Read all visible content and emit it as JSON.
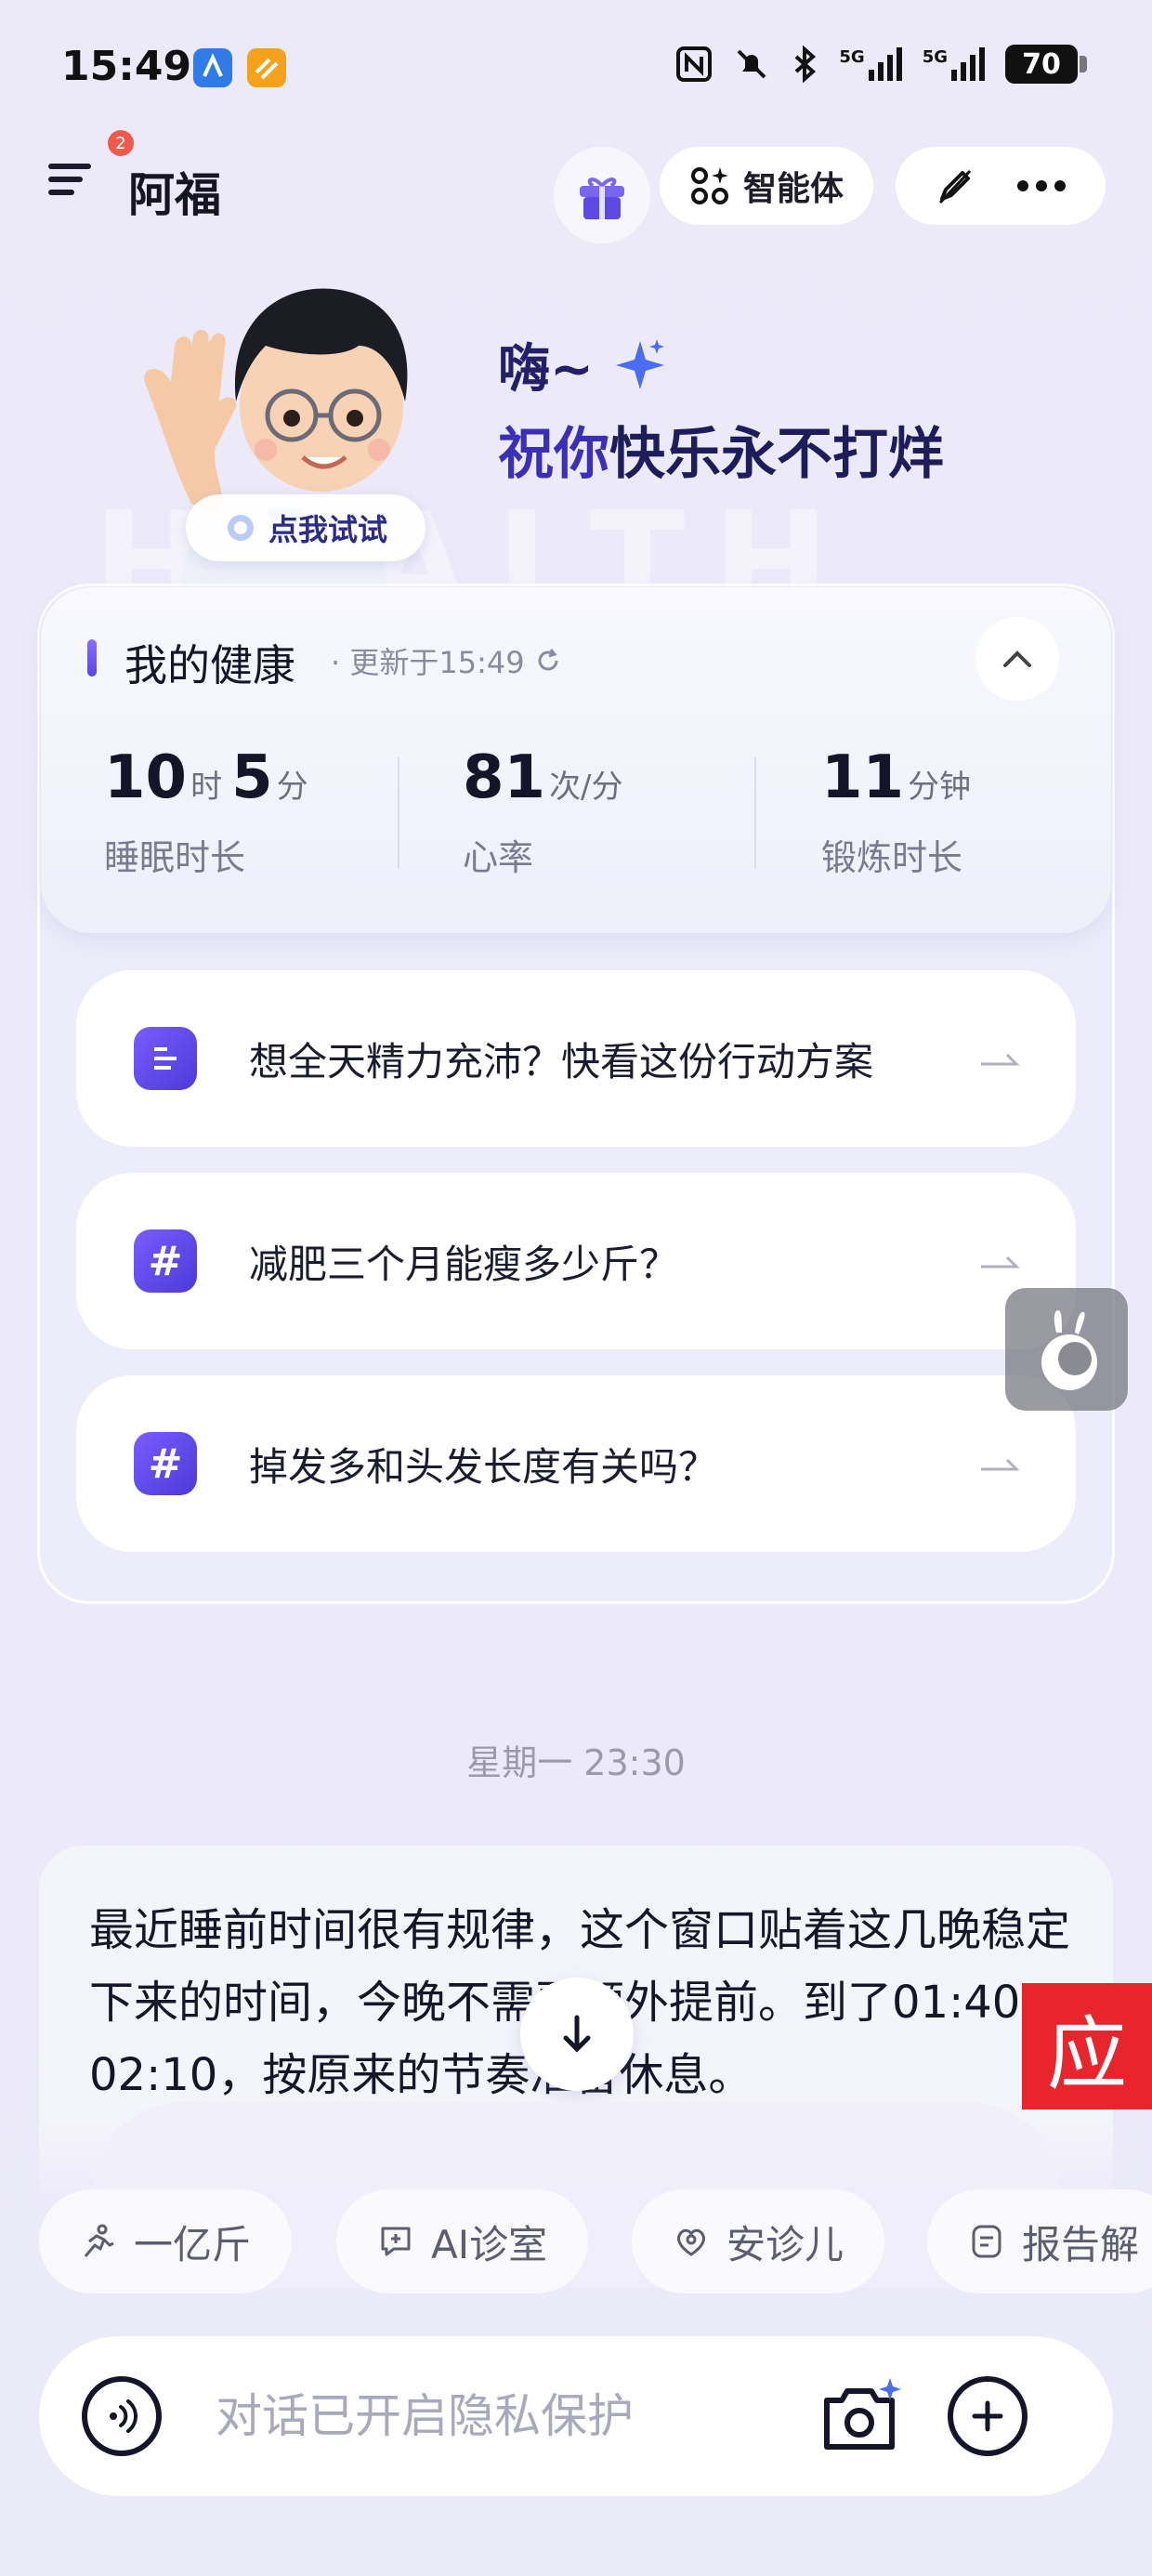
{
  "status_bar": {
    "time": "15:49",
    "battery": "70",
    "signal_1": "5G",
    "signal_2": "5G"
  },
  "header": {
    "menu_badge": "2",
    "title": "阿福",
    "agent_label": "智能体"
  },
  "hero": {
    "greeting": "嗨~",
    "subtitle_part1": "祝你",
    "subtitle_part2": "快乐永不打烊",
    "try_button": "点我试试",
    "watermark": "HEALTH"
  },
  "health": {
    "title": "我的健康",
    "updated": "· 更新于15:49",
    "metrics": [
      {
        "value_a": "10",
        "unit_a": "时",
        "value_b": "5",
        "unit_b": "分",
        "label": "睡眠时长"
      },
      {
        "value_a": "81",
        "unit_a": "次/分",
        "label": "心率"
      },
      {
        "value_a": "11",
        "unit_a": "分钟",
        "label": "锻炼时长"
      }
    ]
  },
  "suggestions": [
    {
      "icon": "document-list-icon",
      "text": "想全天精力充沛？快看这份行动方案"
    },
    {
      "icon": "hashtag-icon",
      "text": "减肥三个月能瘦多少斤？"
    },
    {
      "icon": "hashtag-icon",
      "text": "掉发多和头发长度有关吗？"
    }
  ],
  "chat": {
    "timestamp": "星期一 23:30",
    "message": "最近睡前时间很有规律，这个窗口贴着这几晚稳定下来的时间，今晚不需要额外提前。到了01:40-02:10，按原来的节奏准备休息。",
    "badge_char": "应"
  },
  "chips": [
    {
      "icon": "running-icon",
      "label": "一亿斤"
    },
    {
      "icon": "ai-clinic-icon",
      "label": "AI诊室"
    },
    {
      "icon": "child-care-icon",
      "label": "安诊儿"
    },
    {
      "icon": "report-icon",
      "label": "报告解"
    }
  ],
  "input": {
    "placeholder": "对话已开启隐私保护"
  },
  "colors": {
    "accent": "#4c3ad8",
    "background": "#eceaf9",
    "badge_red": "#e8242d"
  }
}
